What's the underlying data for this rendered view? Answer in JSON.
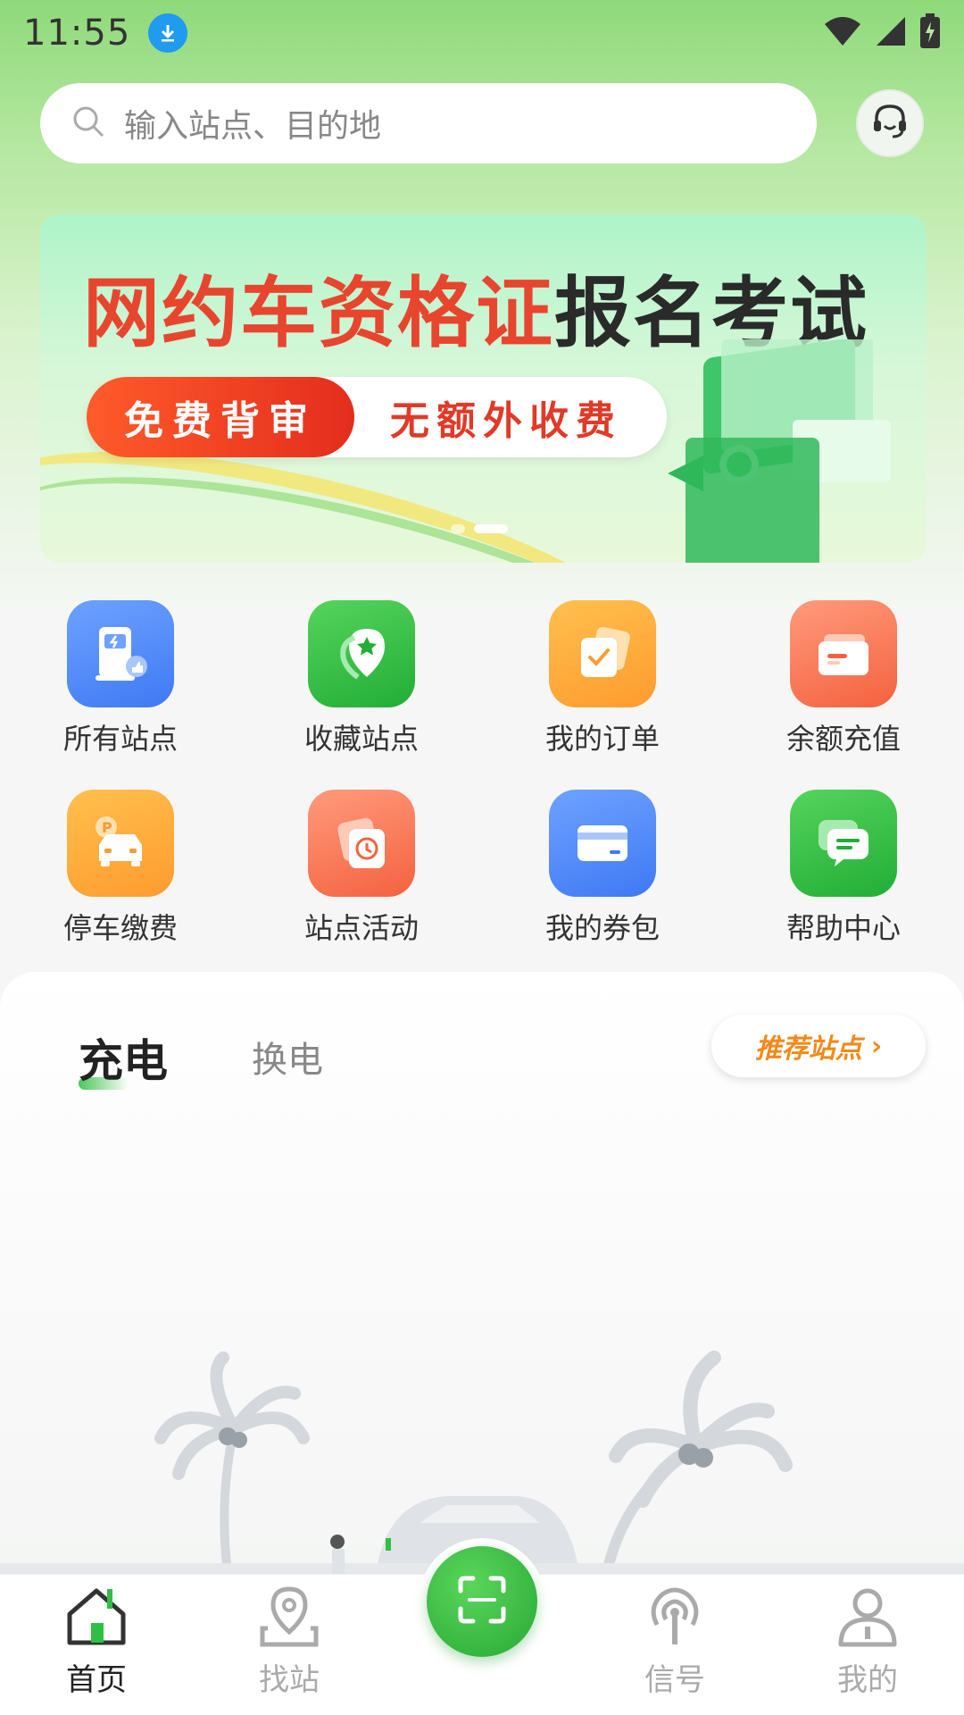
{
  "status_bar": {
    "time": "11:55"
  },
  "search": {
    "placeholder": "输入站点、目的地"
  },
  "banner": {
    "title_red": "网约车资格证",
    "title_dark": "报名考试",
    "pill_left": "免费背审",
    "pill_right": "无额外收费",
    "page_count": 2,
    "active_page": 2
  },
  "quick_actions": [
    {
      "label": "所有站点",
      "icon": "charging-station-icon",
      "color": "#4f86f7"
    },
    {
      "label": "收藏站点",
      "icon": "star-map-pin-icon",
      "color": "#2fbf45"
    },
    {
      "label": "我的订单",
      "icon": "order-check-icon",
      "color": "#ffa23a"
    },
    {
      "label": "余额充值",
      "icon": "wallet-card-icon",
      "color": "#f8765a"
    },
    {
      "label": "停车缴费",
      "icon": "parking-car-icon",
      "color": "#ffa23a"
    },
    {
      "label": "站点活动",
      "icon": "activity-clock-icon",
      "color": "#f8765a"
    },
    {
      "label": "我的券包",
      "icon": "coupon-card-icon",
      "color": "#3f79f4"
    },
    {
      "label": "帮助中心",
      "icon": "help-chat-icon",
      "color": "#2fbf45"
    }
  ],
  "station_tabs": {
    "charge": "充电",
    "swap": "换电",
    "recommend": "推荐站点"
  },
  "bottom_nav": [
    {
      "label": "首页",
      "icon": "home-icon",
      "active": true
    },
    {
      "label": "找站",
      "icon": "location-pin-icon",
      "active": false
    },
    {
      "label": "信号",
      "icon": "signal-broadcast-icon",
      "active": false
    },
    {
      "label": "我的",
      "icon": "profile-icon",
      "active": false
    }
  ],
  "colors": {
    "brand_green": "#2fbf45",
    "accent_orange": "#f08a1c",
    "banner_red": "#e8452e"
  }
}
